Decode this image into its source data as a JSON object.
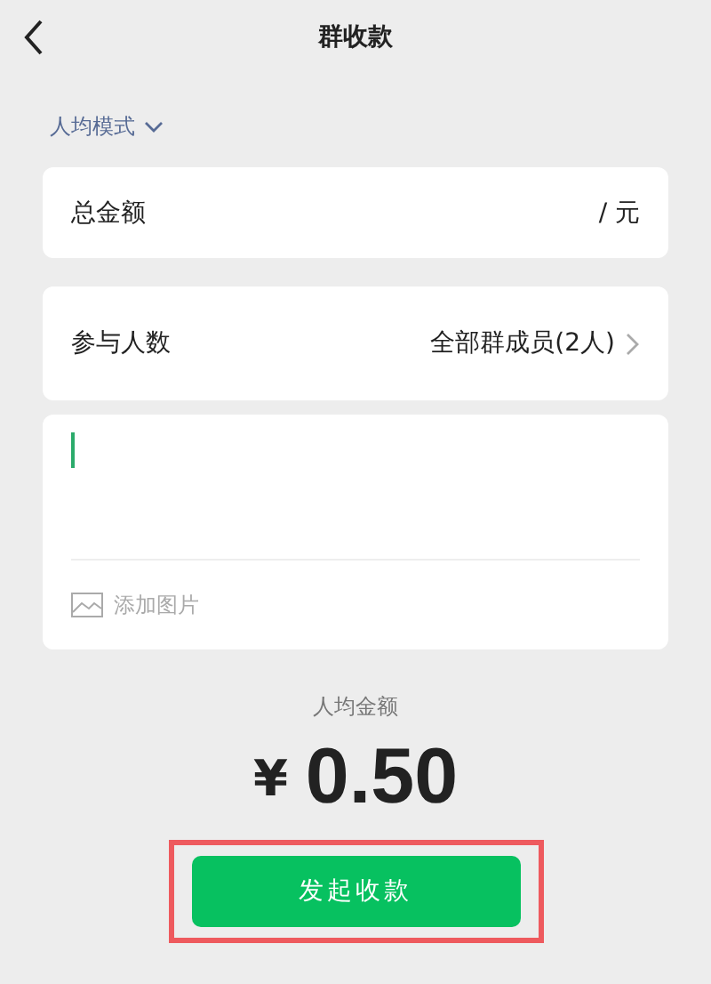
{
  "header": {
    "title": "群收款"
  },
  "mode": {
    "label": "人均模式"
  },
  "total": {
    "label": "总金额",
    "unit": "/ 元"
  },
  "participants": {
    "label": "参与人数",
    "value": "全部群成员(2人)"
  },
  "note": {
    "add_image": "添加图片"
  },
  "summary": {
    "label": "人均金额",
    "currency": "¥",
    "amount": "0.50"
  },
  "submit": {
    "label": "发起收款",
    "highlighted": true
  }
}
